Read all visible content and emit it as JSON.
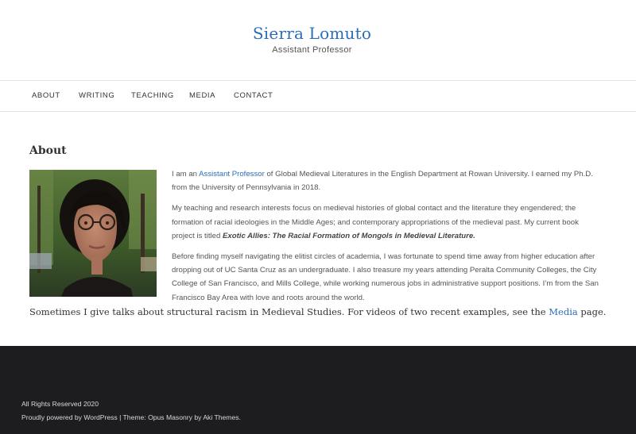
{
  "header": {
    "site_title": "Sierra Lomuto",
    "tagline": "Assistant Professor"
  },
  "nav": {
    "items": [
      {
        "label": "ABOUT"
      },
      {
        "label": "WRITING"
      },
      {
        "label": "TEACHING"
      },
      {
        "label": "MEDIA"
      },
      {
        "label": "CONTACT"
      }
    ]
  },
  "main": {
    "page_title": "About",
    "photo_icon": "portrait-photo",
    "p1_before": "I am an ",
    "p1_link": "Assistant Professor",
    "p1_after": " of Global Medieval Literatures in the English Department at Rowan University. I earned my Ph.D. from the University of Pennsylvania in 2018.",
    "p2_text": "My teaching and research interests focus on medieval histories of global contact and the literature they engendered; the formation of racial ideologies in the Middle Ages; and contemporary appropriations of the medieval past. My current book project is titled ",
    "p2_book": "Exotic Allies: The Racial Formation of Mongols in Medieval Literature.",
    "p3_text": "Before finding myself navigating the elitist circles of academia, I was fortunate to spend time away from higher education after dropping out of UC Santa Cruz as an undergraduate. I also treasure my years attending Peralta Community Colleges, the City College of San Francisco, and Mills College, while working numerous jobs in administrative support positions. I’m from the San Francisco Bay Area with love and roots around the world.",
    "talks_before": "Sometimes I give talks about structural racism in Medieval Studies. For videos of two recent examples, see the ",
    "talks_link": "Media",
    "talks_after": " page."
  },
  "footer": {
    "rights": "All Rights Reserved 2020",
    "powered_link": "Proudly powered by WordPress",
    "separator": " | ",
    "theme_text": "Theme: Opus Masonry by Aki Themes."
  },
  "colors": {
    "accent": "#2a6eb8",
    "footer_bg": "#1d1d1f"
  }
}
